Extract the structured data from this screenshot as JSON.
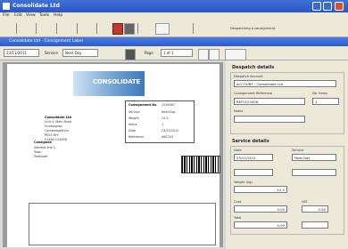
{
  "window": {
    "title": "Consolidate Ltd"
  },
  "menu": [
    "File",
    "Edit",
    "View",
    "Tools",
    "Help"
  ],
  "toolbar": {
    "info": "Despatching a consignment"
  },
  "document": {
    "title": "Consolidate Ltd - Consignment Label",
    "fields": {
      "label1": "Service",
      "value1": "Next Day",
      "label2": "Page",
      "value2": "1 of 1",
      "value0": "23/11/2011"
    }
  },
  "label": {
    "logo": "CONSOLIDATE",
    "sender": [
      "Consolidate Ltd",
      "Unit 4, Main Road",
      "Huntingdon",
      "Cambridgeshire",
      "PE29 6YY",
      "01480 123456"
    ],
    "deliver_to": [
      "Consignee",
      "Address line 1",
      "Town",
      "Postcode"
    ],
    "box_lines": [
      "Consignment No",
      "Service",
      "Weight",
      "Items",
      "Date",
      "Reference"
    ],
    "box_values": [
      "1234567",
      "Next Day",
      "12.5",
      "1",
      "23/11/2011",
      "ABC123"
    ]
  },
  "panel": {
    "section1": "Despatch details",
    "account_label": "Despatch Account",
    "account_value": "ACCOUNT : Consolidate Ltd",
    "ref_label": "Consignment Reference",
    "ref_value": "REF0123456",
    "items_label": "No. Items",
    "items_value": "1",
    "notes_label": "Notes",
    "section2": "Service details",
    "date_label": "Date",
    "date_value": "23/11/2011",
    "service_label": "Service",
    "service_value": "Next Day",
    "weight_label": "Weight (kg)",
    "weight_value": "12.5",
    "cost_label": "Cost",
    "cost_value": "0.00",
    "vat_label": "VAT",
    "vat_value": "0.00",
    "total_label": "Total",
    "total_value": "0.00"
  },
  "colors": {
    "titlebar": "#2a58c0",
    "page": "#ffffff",
    "panel": "#ece9d8"
  }
}
